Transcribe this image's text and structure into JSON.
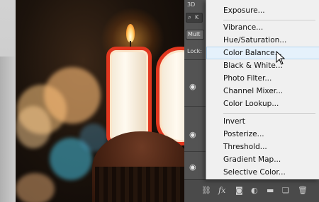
{
  "panel": {
    "tab_label": "3D",
    "search_kind": "K",
    "blend_mode": "Mult",
    "lock_label": "Lock:"
  },
  "menu": {
    "items": [
      "Exposure...",
      "Vibrance...",
      "Hue/Saturation...",
      "Color Balance...",
      "Black & White...",
      "Photo Filter...",
      "Channel Mixer...",
      "Color Lookup...",
      "Invert",
      "Posterize...",
      "Threshold...",
      "Gradient Map...",
      "Selective Color..."
    ],
    "hovered": "Color Balance..."
  },
  "footer": {
    "fx_label": "fx"
  },
  "colors": {
    "menu_bg": "#f0f0f0",
    "menu_hover": "#e5f1fb",
    "panel_bg": "#535353",
    "candle_stripe": "#e1371f"
  },
  "icons": [
    "search-icon",
    "eye-icon",
    "link-icon",
    "fx-icon",
    "mask-icon",
    "adjustment-icon",
    "folder-icon",
    "new-layer-icon",
    "trash-icon",
    "cursor-icon"
  ]
}
